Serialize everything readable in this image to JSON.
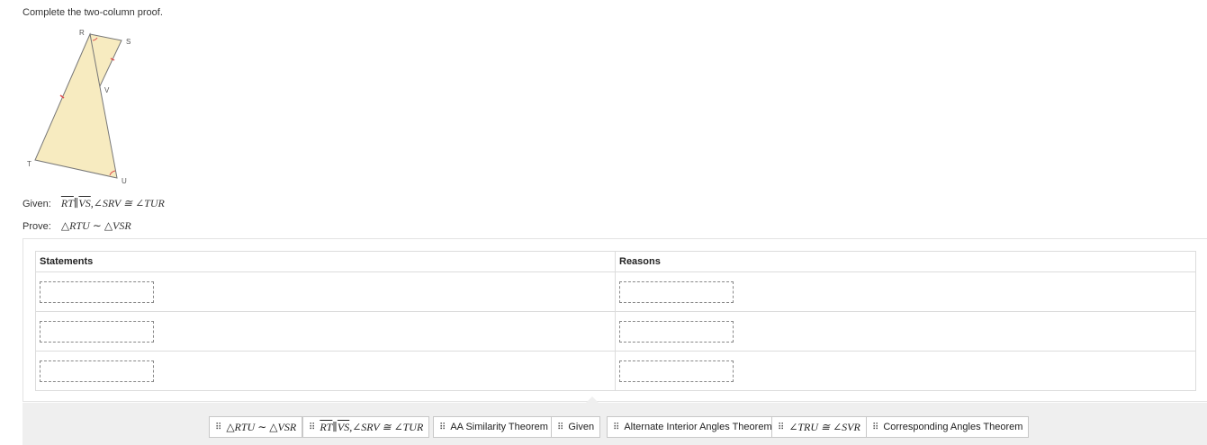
{
  "instruction": "Complete the two-column proof.",
  "figure": {
    "vertices": [
      "R",
      "S",
      "V",
      "T",
      "U"
    ]
  },
  "given": {
    "label": "Given:",
    "seg1": "RT",
    "parallel": "∥",
    "seg2": "VS",
    "rest": ",∠SRV ≅ ∠TUR"
  },
  "prove": {
    "label": "Prove:",
    "statement": "△RTU ∼ △VSR"
  },
  "table": {
    "col_statements": "Statements",
    "col_reasons": "Reasons",
    "rows": 3
  },
  "bank": {
    "grip_glyph": "⠿",
    "chips": [
      {
        "text": "△RTU ∼ △VSR",
        "math": true
      },
      {
        "seg1": "RT",
        "parallel": "∥",
        "seg2": "VS",
        "rest": ",∠SRV ≅ ∠TUR",
        "math": true,
        "composite": true
      },
      {
        "text": "AA Similarity Theorem",
        "math": false
      },
      {
        "text": "Given",
        "math": false
      },
      {
        "text": "Alternate Interior Angles Theorem",
        "math": false
      },
      {
        "text": "∠TRU ≅ ∠SVR",
        "math": true
      },
      {
        "text": "Corresponding Angles Theorem",
        "math": false
      }
    ]
  },
  "colors": {
    "figure_fill": "#f7ebc0",
    "figure_stroke": "#777777",
    "tick_mark": "#e05050"
  }
}
